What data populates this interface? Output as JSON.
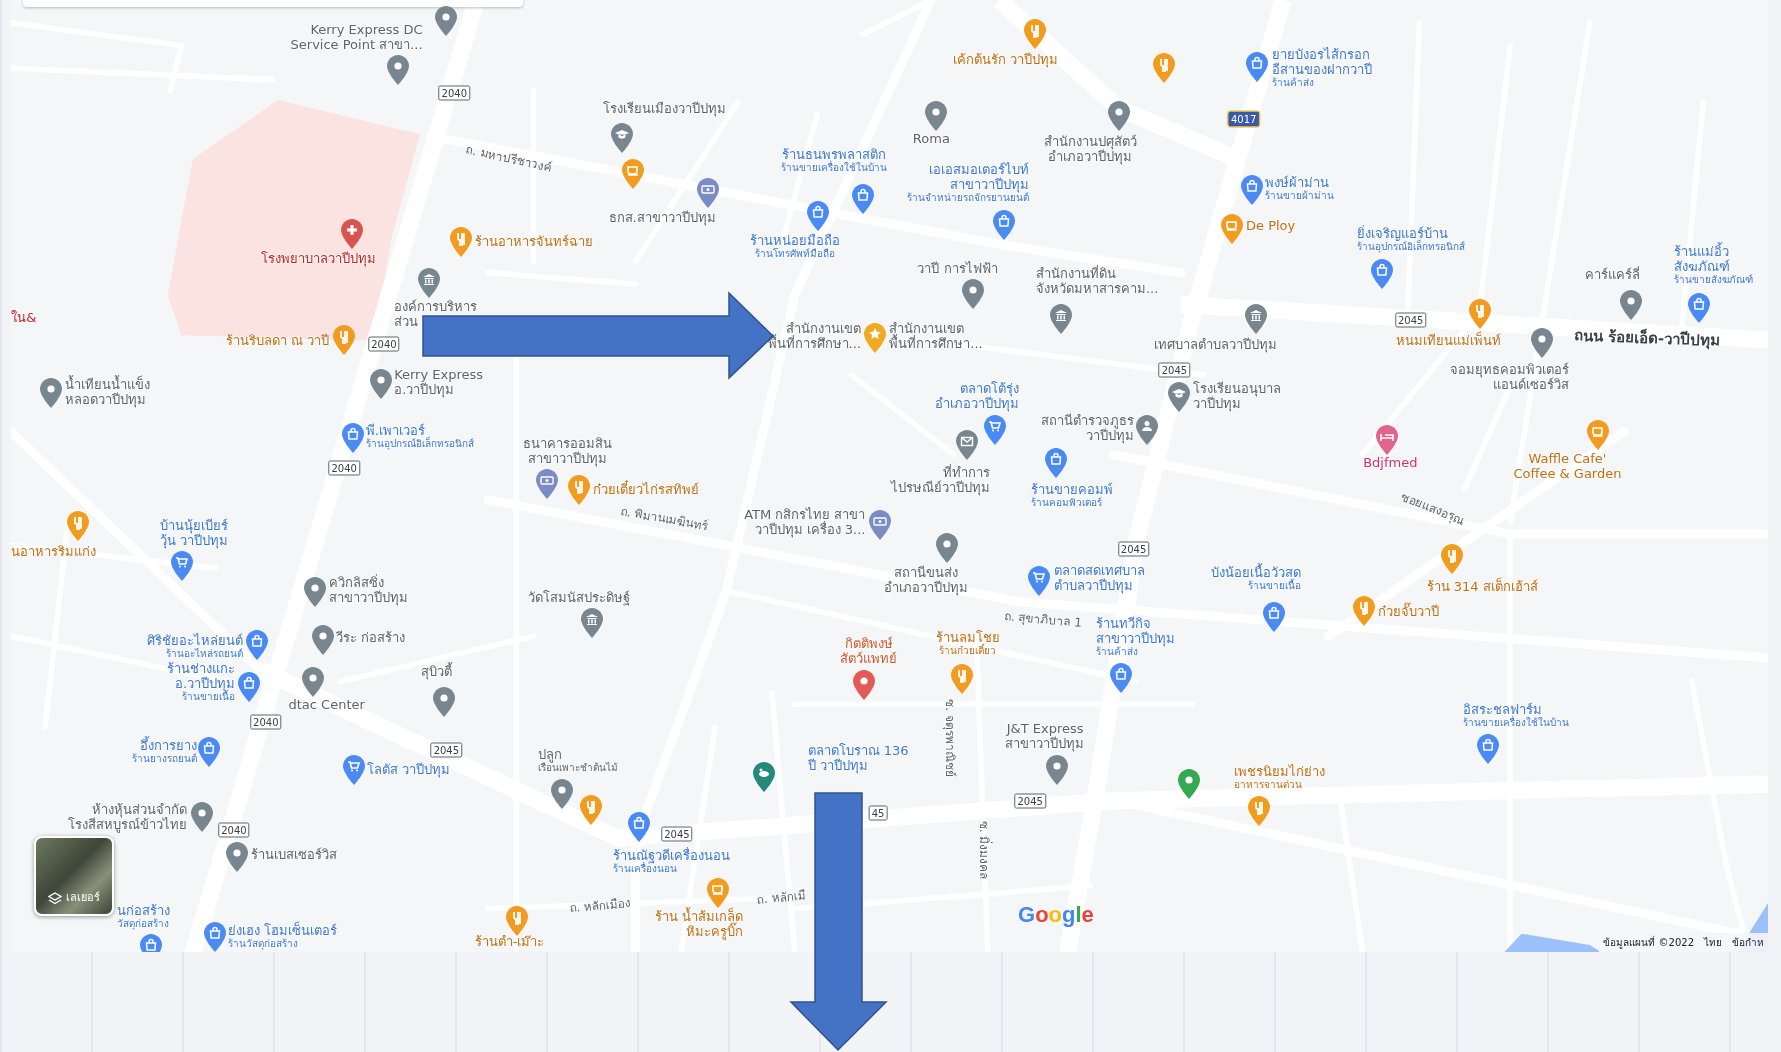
{
  "places": [
    {
      "kind": "generic",
      "name": "Kerry Express DC\nService Point สาขา..."
    },
    {
      "kind": "generic"
    },
    {
      "kind": "food",
      "name": "เค้กต้นรัก วาปีปทุม"
    },
    {
      "kind": "food"
    },
    {
      "kind": "shop",
      "name": "ยายบังอรไส้กรอก\nอีสานของฝากวาปี",
      "category": "ร้านค้าส่ง"
    },
    {
      "kind": "school",
      "name": "โรงเรียนเมืองวาปีปทุม"
    },
    {
      "kind": "cafe"
    },
    {
      "kind": "shop",
      "name": "ร้านธนพรพลาสติก",
      "category": "ร้านขายเครื่องใช้ในบ้าน"
    },
    {
      "kind": "generic",
      "name": "Roma"
    },
    {
      "kind": "shop",
      "name": "เอเอสมอเตอร์ไบท์\nสาขาวาปีปทุม",
      "category": "ร้านจำหน่ายรถจักรยานยนต์"
    },
    {
      "kind": "generic",
      "name": "สำนักงานปศุสัตว์\nอำเภอวาปีปทุม"
    },
    {
      "kind": "shop",
      "name": "พงษ์ผ้าม่าน",
      "category": "ร้านขายผ้าม่าน"
    },
    {
      "kind": "hospital",
      "name": "โรงพยาบาลวาปีปทุม"
    },
    {
      "kind": "food",
      "name": "ร้านอาหารจันทร์ฉาย"
    },
    {
      "kind": "bank",
      "name": "ธกส.สาขาวาปีปทุม"
    },
    {
      "kind": "shop",
      "name": "ร้านหน่อยมือถือ",
      "category": "ร้านโทรศัพท์มือถือ"
    },
    {
      "kind": "generic",
      "name": "วาปี การไฟฟ้า"
    },
    {
      "kind": "gov",
      "name": "สำนักงานที่ดิน\nจังหวัดมหาสารคาม..."
    },
    {
      "kind": "cafe",
      "name": "De Ploy"
    },
    {
      "kind": "shop",
      "name": "ยิ่งเจริญแอร์บ้าน",
      "category": "ร้านอุปกรณ์อิเล็กทรอนิกส์"
    },
    {
      "kind": "generic",
      "name": "คาร์แคร์ลี่"
    },
    {
      "kind": "shop",
      "name": "ร้านแม่อิ้ว\nสังฆภัณฑ์",
      "category": "ร้านขายสังฆภัณฑ์"
    },
    {
      "kind": "hospital",
      "name": "ใน&"
    },
    {
      "kind": "food",
      "name": "ร้านริบลดา ณ วาปี"
    },
    {
      "kind": "gov",
      "name": "องค์การบริหาร\nส่วน"
    },
    {
      "kind": "star",
      "name": "สำนักงานเขต\nพื้นที่การศึกษา..."
    },
    {
      "kind": "star",
      "name": "สำนักงานเขต\nพื้นที่การศึกษา..."
    },
    {
      "kind": "gov",
      "name": "เทศบาลตำบลวาปีปทุม"
    },
    {
      "kind": "food",
      "name": "หนมเทียนแม่เพ็นท์"
    },
    {
      "kind": "generic",
      "name": "น้ำเทียนน้ำแข็ง\nหลอดวาปีปทุม"
    },
    {
      "kind": "generic",
      "name": "Kerry Express\nอ.วาปีปทุม"
    },
    {
      "kind": "grocery",
      "name": "ตลาดโต้รุ่ง\nอำเภอวาปีปทุม"
    },
    {
      "kind": "police",
      "name": "สถานีตำรวจภูธร\nวาปีปทุม"
    },
    {
      "kind": "school",
      "name": "โรงเรียนอนุบาล\nวาปีปทุม"
    },
    {
      "kind": "generic",
      "name": "จอมยุทธคอมพิวเตอร์\nแอนด์เซอร์วิส"
    },
    {
      "kind": "shop",
      "name": "พี.เพาเวอร์",
      "category": "ร้านอุปกรณ์อิเล็กทรอนิกส์"
    },
    {
      "kind": "bank",
      "name": "ธนาคารออมสิน\nสาขาวาปีปทุม"
    },
    {
      "kind": "food",
      "name": "ก๋วยเตี๋ยวไก่รสทิพย์"
    },
    {
      "kind": "mail",
      "name": "ที่ทำการ\nไปรษณีย์วาปีปทุม"
    },
    {
      "kind": "shop",
      "name": "ร้านขายคอมพ์",
      "category": "ร้านคอมพิวเตอร์"
    },
    {
      "kind": "health",
      "name": "Bdjfmed"
    },
    {
      "kind": "cafe",
      "name": "Waffle Cafe'\nCoffee & Garden"
    },
    {
      "kind": "food",
      "name": "นอาหารริมแก่ง"
    },
    {
      "kind": "grocery",
      "name": "บ้านนุ้ยเบียร์\nวุ้น วาปีปทุม"
    },
    {
      "kind": "bank",
      "name": "ATM กสิกรไทย สาขา\nวาปีปทุม เครื่อง 3..."
    },
    {
      "kind": "generic",
      "name": "ควิกลิสซิ่ง\nสาขาวาปีปทุม"
    },
    {
      "kind": "temple",
      "name": "วัดโสมนัสประดิษฐ์"
    },
    {
      "kind": "generic",
      "name": "สถานีขนส่ง\nอำเภอวาปีปทุม"
    },
    {
      "kind": "grocery",
      "name": "ตลาดสดเทศบาล\nตำบลวาปีปทุม"
    },
    {
      "kind": "shop",
      "name": "บังน้อยเนื้อวัวสด",
      "category": "ร้านขายเนื้อ"
    },
    {
      "kind": "food",
      "name": "ร้าน 314 สเต็กเฮ้าส์"
    },
    {
      "kind": "food",
      "name": "ก๋วยจั๊บวาปี"
    },
    {
      "kind": "shop",
      "name": "ศิริชัยอะไหล่ยนต์",
      "category": "ร้านอะไหล่รถยนต์"
    },
    {
      "kind": "generic",
      "name": "วีระ ก่อสร้าง"
    },
    {
      "kind": "vet",
      "name": "กิตติพงษ์\nสัตว์แพทย์"
    },
    {
      "kind": "food",
      "name": "ร้านลมโชย",
      "category": "ร้านก๋วยเตี๋ยว"
    },
    {
      "kind": "shop",
      "name": "ร้านทวีกิจ\nสาขาวาปีปทุม",
      "category": "ร้านค้าส่ง"
    },
    {
      "kind": "shop",
      "name": "ร้านช่างแกะ\nอ.วาปีปทุม",
      "category": "ร้านขายเนื้อ"
    },
    {
      "kind": "generic",
      "name": "สุบิวตี้"
    },
    {
      "kind": "generic",
      "name": "dtac Center"
    },
    {
      "kind": "shop",
      "name": "อึ้งการยาง",
      "category": "ร้านยางรถยนต์"
    },
    {
      "kind": "grocery",
      "name": "โลตัส วาปีปทุม"
    },
    {
      "kind": "generic",
      "name": "ปลูก",
      "category": "เรือนเพาะชำต้นไม้"
    },
    {
      "kind": "food"
    },
    {
      "kind": "park"
    },
    {
      "kind": "grocery",
      "name": "ตลาดโบราณ 136\nปี วาปีปทุม"
    },
    {
      "kind": "generic",
      "name": "J&T Express\nสาขาวาปีปทุม"
    },
    {
      "kind": "green"
    },
    {
      "kind": "food",
      "name": "เพชรนิยมไก่ย่าง",
      "category": "อาหารจานด่วน"
    },
    {
      "kind": "shop",
      "name": "อิสระชลฟาร์ม",
      "category": "ร้านขายเครื่องใช้ในบ้าน"
    },
    {
      "kind": "generic",
      "name": "ห้างหุ้นส่วนจำกัด\nโรงสีสหบูรณ์ข้าวไทย"
    },
    {
      "kind": "generic",
      "name": "ร้านเบสเซอร์วิส"
    },
    {
      "kind": "shop",
      "name": "ร้านณัฐวดีเครื่องนอน",
      "category": "ร้านเครื่องนอน"
    },
    {
      "kind": "shop",
      "name": "นก่อสร้าง",
      "category": "วัสดุก่อสร้าง"
    },
    {
      "kind": "shop",
      "name": "ย่งเฮง โฮมเซ็นเตอร์",
      "category": "ร้านวัสดุก่อสร้าง"
    },
    {
      "kind": "food",
      "name": "ร้านตำ-เม๊าะ"
    },
    {
      "kind": "cafe",
      "name": "ร้าน น้ำส้มเกล็ด\nหิมะครูบิ๊ก"
    }
  ],
  "route_shields": [
    {
      "number": "2040",
      "kind": "local"
    },
    {
      "number": "2040",
      "kind": "local"
    },
    {
      "number": "2040",
      "kind": "local"
    },
    {
      "number": "2040",
      "kind": "local"
    },
    {
      "number": "2040",
      "kind": "local"
    },
    {
      "number": "2045",
      "kind": "local"
    },
    {
      "number": "2045",
      "kind": "local"
    },
    {
      "number": "2045",
      "kind": "local"
    },
    {
      "number": "2045",
      "kind": "local"
    },
    {
      "number": "2045",
      "kind": "local"
    },
    {
      "number": "2045",
      "kind": "local"
    },
    {
      "number": "45",
      "kind": "local"
    },
    {
      "number": "4017",
      "kind": "highway"
    }
  ],
  "road_labels": [
    {
      "name": "ถ. มหาปรีชาวงค์"
    },
    {
      "name": "ถ. พิมานเมฆินทร์"
    },
    {
      "name": "ถ. สุขาภิบาล 1"
    },
    {
      "name": "ถนน ร้อยเอ็ด-วาปีปทุม",
      "kind": "major"
    },
    {
      "name": "ซอยแสงอรุณ"
    },
    {
      "name": "ซ. จตุรพาณิชย์"
    },
    {
      "name": "ซ. มิ่งมงคล"
    },
    {
      "name": "ถ. หลักเมือง"
    },
    {
      "name": "ถ. หลักเมื"
    }
  ],
  "layers_button": {
    "label": "เลเยอร์"
  },
  "logo": "Google",
  "attribution": {
    "map_data": "ข้อมูลแผนที่ ©2022",
    "language": "ไทย",
    "terms": "ข้อกำห"
  }
}
